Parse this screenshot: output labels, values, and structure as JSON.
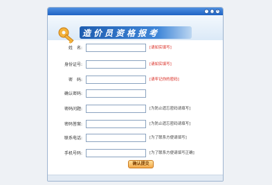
{
  "window": {
    "controls": [
      "-",
      "□",
      "×"
    ]
  },
  "banner": {
    "title": "造价员资格报考",
    "icon": "key-icon"
  },
  "form": {
    "fields": [
      {
        "label": "姓　名:",
        "value": "",
        "hint": "[请如实填写]",
        "hint_color": "red"
      },
      {
        "label": "身份证号:",
        "value": "",
        "hint": "[请如实填写]",
        "hint_color": "red"
      },
      {
        "label": "密　码:",
        "value": "",
        "hint": "[请牢记你的密码]",
        "hint_color": "red"
      },
      {
        "label": "确认密码:",
        "value": "",
        "hint": "",
        "hint_color": "gray"
      },
      {
        "label": "密码问题:",
        "value": "",
        "hint": "[为防止遗忘密码请填写]",
        "hint_color": "gray"
      },
      {
        "label": "密码答案:",
        "value": "",
        "hint": "[为防止遗忘密码请填写]",
        "hint_color": "gray"
      },
      {
        "label": "联系电话:",
        "value": "",
        "hint": "[为了联系方便请填写]",
        "hint_color": "gray"
      },
      {
        "label": "手机号码:",
        "value": "",
        "hint": "[为了联系方便请填写正确]",
        "hint_color": "gray"
      }
    ],
    "submit_label": "确认提交"
  },
  "colors": {
    "accent": "#1f63c4",
    "hint_red": "#d8241b",
    "button": "#f3a94a"
  }
}
